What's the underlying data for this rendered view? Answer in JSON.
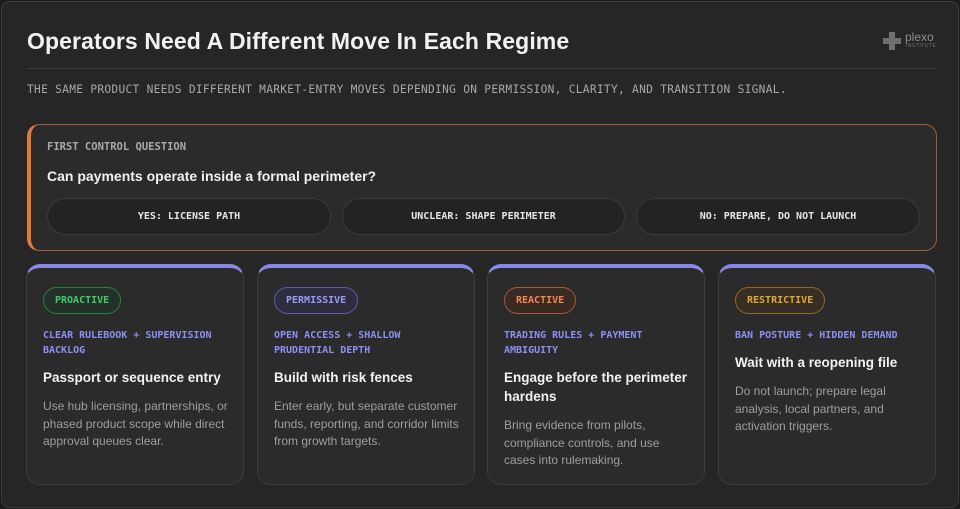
{
  "title": "Operators Need A Different Move In Each Regime",
  "subtitle": "THE SAME PRODUCT NEEDS DIFFERENT MARKET-ENTRY MOVES DEPENDING ON PERMISSION, CLARITY, AND TRANSITION SIGNAL.",
  "logo": {
    "name": "plexo",
    "sub": "INSTITUTE"
  },
  "control": {
    "label": "FIRST CONTROL QUESTION",
    "question": "Can payments operate inside a formal perimeter?",
    "options": [
      "YES: LICENSE PATH",
      "UNCLEAR: SHAPE PERIMETER",
      "NO: PREPARE, DO NOT LAUNCH"
    ]
  },
  "cards": [
    {
      "badge": "PROACTIVE",
      "tag": "CLEAR RULEBOOK + SUPERVISION BACKLOG",
      "heading": "Passport or sequence entry",
      "body": "Use hub licensing, partnerships, or phased product scope while direct approval queues clear."
    },
    {
      "badge": "PERMISSIVE",
      "tag": "OPEN ACCESS + SHALLOW PRUDENTIAL DEPTH",
      "heading": "Build with risk fences",
      "body": "Enter early, but separate customer funds, reporting, and corridor limits from growth targets."
    },
    {
      "badge": "REACTIVE",
      "tag": "TRADING RULES + PAYMENT AMBIGUITY",
      "heading": "Engage before the perimeter hardens",
      "body": "Bring evidence from pilots, compliance controls, and use cases into rulemaking."
    },
    {
      "badge": "RESTRICTIVE",
      "tag": "BAN POSTURE + HIDDEN DEMAND",
      "heading": "Wait with a reopening file",
      "body": "Do not launch; prepare legal analysis, local partners, and activation triggers."
    }
  ],
  "colors": {
    "accent": "#8787e8",
    "control_border": "#e07a3c",
    "proactive": "#45c86b",
    "permissive": "#9a9af3",
    "reactive": "#ef874d",
    "restrictive": "#e0a735"
  }
}
